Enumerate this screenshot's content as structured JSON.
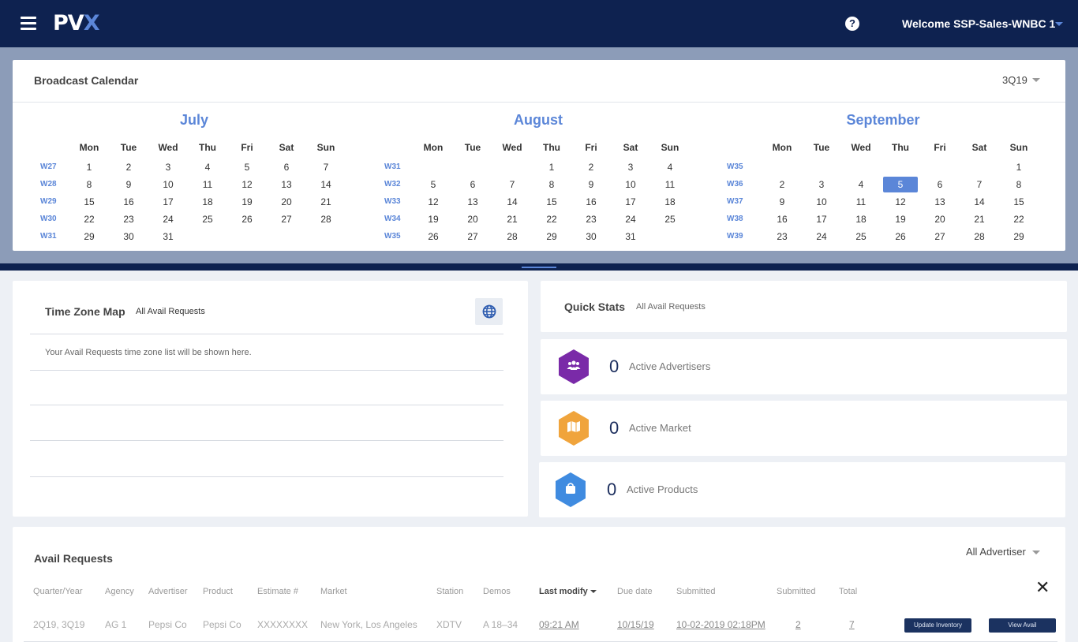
{
  "header": {
    "logo_main": "PV",
    "logo_accent": "X",
    "help_icon": "?",
    "welcome": "Welcome SSP-Sales-WNBC 1"
  },
  "calendar": {
    "title": "Broadcast Calendar",
    "quarter": "3Q19",
    "days_of_week": [
      "Mon",
      "Tue",
      "Wed",
      "Thu",
      "Fri",
      "Sat",
      "Sun"
    ],
    "months": [
      {
        "name": "July",
        "weeks": [
          {
            "label": "W27",
            "days": [
              "1",
              "2",
              "3",
              "4",
              "5",
              "6",
              "7"
            ]
          },
          {
            "label": "W28",
            "days": [
              "8",
              "9",
              "10",
              "11",
              "12",
              "13",
              "14"
            ]
          },
          {
            "label": "W29",
            "days": [
              "15",
              "16",
              "17",
              "18",
              "19",
              "20",
              "21"
            ]
          },
          {
            "label": "W30",
            "days": [
              "22",
              "23",
              "24",
              "25",
              "26",
              "27",
              "28"
            ]
          },
          {
            "label": "W31",
            "days": [
              "29",
              "30",
              "31",
              "",
              "",
              "",
              ""
            ]
          }
        ]
      },
      {
        "name": "August",
        "weeks": [
          {
            "label": "W31",
            "days": [
              "",
              "",
              "",
              "1",
              "2",
              "3",
              "4"
            ]
          },
          {
            "label": "W32",
            "days": [
              "5",
              "6",
              "7",
              "8",
              "9",
              "10",
              "11"
            ]
          },
          {
            "label": "W33",
            "days": [
              "12",
              "13",
              "14",
              "15",
              "16",
              "17",
              "18"
            ]
          },
          {
            "label": "W34",
            "days": [
              "19",
              "20",
              "21",
              "22",
              "23",
              "24",
              "25"
            ]
          },
          {
            "label": "W35",
            "days": [
              "26",
              "27",
              "28",
              "29",
              "30",
              "31",
              ""
            ]
          }
        ]
      },
      {
        "name": "September",
        "weeks": [
          {
            "label": "W35",
            "days": [
              "",
              "",
              "",
              "",
              "",
              "",
              "1"
            ]
          },
          {
            "label": "W36",
            "days": [
              "2",
              "3",
              "4",
              "5",
              "6",
              "7",
              "8"
            ]
          },
          {
            "label": "W37",
            "days": [
              "9",
              "10",
              "11",
              "12",
              "13",
              "14",
              "15"
            ]
          },
          {
            "label": "W38",
            "days": [
              "16",
              "17",
              "18",
              "19",
              "20",
              "21",
              "22"
            ]
          },
          {
            "label": "W39",
            "days": [
              "23",
              "24",
              "25",
              "26",
              "27",
              "28",
              "29"
            ]
          }
        ]
      }
    ],
    "selected": {
      "month": "September",
      "day": "5"
    }
  },
  "timezone": {
    "title": "Time Zone Map",
    "filter": "All Avail Requests",
    "message": "Your Avail Requests time zone list will be shown here.",
    "globe_icon": "globe-icon"
  },
  "quick_stats": {
    "title": "Quick Stats",
    "filter": "All Avail Requests",
    "items": [
      {
        "value": "0",
        "label": "Active Advertisers",
        "color": "#7a2aa8",
        "icon": "users-icon"
      },
      {
        "value": "0",
        "label": "Active Market",
        "color": "#f0a43c",
        "icon": "map-icon"
      },
      {
        "value": "0",
        "label": "Active Products",
        "color": "#3f8be0",
        "icon": "bag-icon"
      }
    ]
  },
  "avail_requests": {
    "title": "Avail Requests",
    "advertiser_filter": "All Advertiser",
    "close": "✕",
    "columns": [
      "Quarter/Year",
      "Agency",
      "Advertiser",
      "Product",
      "Estimate #",
      "Market",
      "Station",
      "Demos",
      "Last modify",
      "Due date",
      "Submitted",
      "Submitted",
      "Total"
    ],
    "rows": [
      {
        "quarter": "2Q19, 3Q19",
        "agency": "AG 1",
        "advertiser": "Pepsi Co",
        "product": "Pepsi Co",
        "estimate": "XXXXXXXX",
        "market": "New York, Los Angeles",
        "station": "XDTV",
        "demos": "A 18–34",
        "last_modify": "09:21 AM",
        "due_date": "10/15/19",
        "submitted_date": "10-02-2019 02:18PM",
        "submitted_count": "2",
        "total": "7",
        "update_btn": "Update Inventory",
        "view_btn": "View Avail"
      }
    ]
  },
  "colors": {
    "navy": "#0e2250",
    "accent": "#5b86d8"
  }
}
